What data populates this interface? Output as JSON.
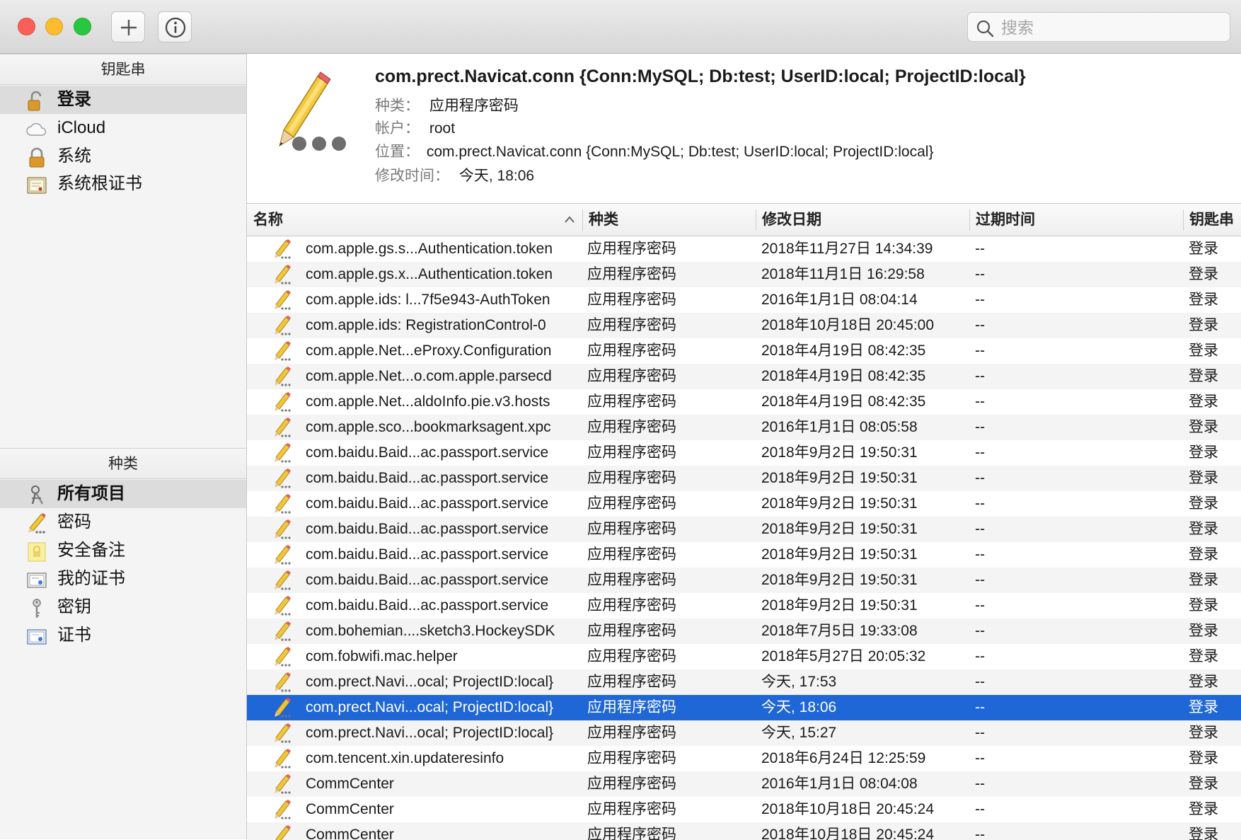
{
  "toolbar": {
    "add_label": "+",
    "info_label": "i",
    "search_placeholder": "搜索"
  },
  "sidebar": {
    "keychains_header": "钥匙串",
    "keychains": [
      {
        "label": "登录",
        "icon": "unlocked-padlock-icon",
        "selected": true
      },
      {
        "label": "iCloud",
        "icon": "cloud-icon",
        "selected": false
      },
      {
        "label": "系统",
        "icon": "locked-padlock-icon",
        "selected": false
      },
      {
        "label": "系统根证书",
        "icon": "certificate-cabinet-icon",
        "selected": false
      }
    ],
    "category_header": "种类",
    "categories": [
      {
        "label": "所有项目",
        "icon": "all-items-icon",
        "selected": true
      },
      {
        "label": "密码",
        "icon": "pencil-icon",
        "selected": false
      },
      {
        "label": "安全备注",
        "icon": "secure-note-icon",
        "selected": false
      },
      {
        "label": "我的证书",
        "icon": "my-certificate-icon",
        "selected": false
      },
      {
        "label": "密钥",
        "icon": "key-icon",
        "selected": false
      },
      {
        "label": "证书",
        "icon": "certificate-icon",
        "selected": false
      }
    ]
  },
  "detail": {
    "title": "com.prect.Navicat.conn {Conn:MySQL; Db:test; UserID:local; ProjectID:local}",
    "kind_label": "种类：",
    "kind_value": "应用程序密码",
    "account_label": "帐户：",
    "account_value": "root",
    "location_label": "位置：",
    "location_value": "com.prect.Navicat.conn {Conn:MySQL; Db:test; UserID:local; ProjectID:local}",
    "modified_label": "修改时间：",
    "modified_value": "今天, 18:06"
  },
  "table": {
    "columns": [
      "名称",
      "种类",
      "修改日期",
      "过期时间",
      "钥匙串"
    ],
    "sorted_column": "名称",
    "rows": [
      {
        "name": "com.apple.gs.s...Authentication.token",
        "kind": "应用程序密码",
        "date": "2018年11月27日 14:34:39",
        "expires": "--",
        "keychain": "登录"
      },
      {
        "name": "com.apple.gs.x...Authentication.token",
        "kind": "应用程序密码",
        "date": "2018年11月1日 16:29:58",
        "expires": "--",
        "keychain": "登录"
      },
      {
        "name": "com.apple.ids: l...7f5e943-AuthToken",
        "kind": "应用程序密码",
        "date": "2016年1月1日 08:04:14",
        "expires": "--",
        "keychain": "登录"
      },
      {
        "name": "com.apple.ids: RegistrationControl-0",
        "kind": "应用程序密码",
        "date": "2018年10月18日 20:45:00",
        "expires": "--",
        "keychain": "登录"
      },
      {
        "name": "com.apple.Net...eProxy.Configuration",
        "kind": "应用程序密码",
        "date": "2018年4月19日 08:42:35",
        "expires": "--",
        "keychain": "登录"
      },
      {
        "name": "com.apple.Net...o.com.apple.parsecd",
        "kind": "应用程序密码",
        "date": "2018年4月19日 08:42:35",
        "expires": "--",
        "keychain": "登录"
      },
      {
        "name": "com.apple.Net...aldoInfo.pie.v3.hosts",
        "kind": "应用程序密码",
        "date": "2018年4月19日 08:42:35",
        "expires": "--",
        "keychain": "登录"
      },
      {
        "name": "com.apple.sco...bookmarksagent.xpc",
        "kind": "应用程序密码",
        "date": "2016年1月1日 08:05:58",
        "expires": "--",
        "keychain": "登录"
      },
      {
        "name": "com.baidu.Baid...ac.passport.service",
        "kind": "应用程序密码",
        "date": "2018年9月2日 19:50:31",
        "expires": "--",
        "keychain": "登录"
      },
      {
        "name": "com.baidu.Baid...ac.passport.service",
        "kind": "应用程序密码",
        "date": "2018年9月2日 19:50:31",
        "expires": "--",
        "keychain": "登录"
      },
      {
        "name": "com.baidu.Baid...ac.passport.service",
        "kind": "应用程序密码",
        "date": "2018年9月2日 19:50:31",
        "expires": "--",
        "keychain": "登录"
      },
      {
        "name": "com.baidu.Baid...ac.passport.service",
        "kind": "应用程序密码",
        "date": "2018年9月2日 19:50:31",
        "expires": "--",
        "keychain": "登录"
      },
      {
        "name": "com.baidu.Baid...ac.passport.service",
        "kind": "应用程序密码",
        "date": "2018年9月2日 19:50:31",
        "expires": "--",
        "keychain": "登录"
      },
      {
        "name": "com.baidu.Baid...ac.passport.service",
        "kind": "应用程序密码",
        "date": "2018年9月2日 19:50:31",
        "expires": "--",
        "keychain": "登录"
      },
      {
        "name": "com.baidu.Baid...ac.passport.service",
        "kind": "应用程序密码",
        "date": "2018年9月2日 19:50:31",
        "expires": "--",
        "keychain": "登录"
      },
      {
        "name": "com.bohemian....sketch3.HockeySDK",
        "kind": "应用程序密码",
        "date": "2018年7月5日 19:33:08",
        "expires": "--",
        "keychain": "登录"
      },
      {
        "name": "com.fobwifi.mac.helper",
        "kind": "应用程序密码",
        "date": "2018年5月27日 20:05:32",
        "expires": "--",
        "keychain": "登录"
      },
      {
        "name": "com.prect.Navi...ocal; ProjectID:local}",
        "kind": "应用程序密码",
        "date": "今天, 17:53",
        "expires": "--",
        "keychain": "登录"
      },
      {
        "name": "com.prect.Navi...ocal; ProjectID:local}",
        "kind": "应用程序密码",
        "date": "今天, 18:06",
        "expires": "--",
        "keychain": "登录",
        "selected": true
      },
      {
        "name": "com.prect.Navi...ocal; ProjectID:local}",
        "kind": "应用程序密码",
        "date": "今天, 15:27",
        "expires": "--",
        "keychain": "登录"
      },
      {
        "name": "com.tencent.xin.updateresinfo",
        "kind": "应用程序密码",
        "date": "2018年6月24日 12:25:59",
        "expires": "--",
        "keychain": "登录"
      },
      {
        "name": "CommCenter",
        "kind": "应用程序密码",
        "date": "2016年1月1日 08:04:08",
        "expires": "--",
        "keychain": "登录"
      },
      {
        "name": "CommCenter",
        "kind": "应用程序密码",
        "date": "2018年10月18日 20:45:24",
        "expires": "--",
        "keychain": "登录"
      },
      {
        "name": "CommCenter",
        "kind": "应用程序密码",
        "date": "2018年10月18日 20:45:24",
        "expires": "--",
        "keychain": "登录"
      }
    ]
  },
  "colors": {
    "selection": "#1f66d6",
    "row_alt": "#f4f4f5"
  }
}
